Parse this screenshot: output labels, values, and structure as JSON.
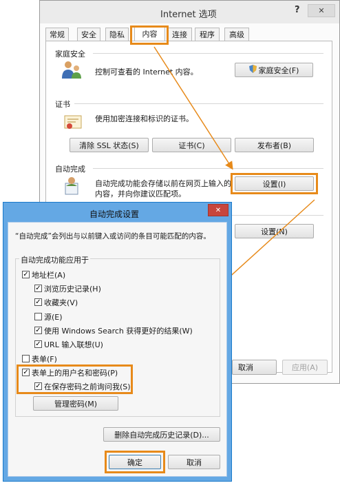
{
  "internet_options": {
    "title": "Internet 选项",
    "help_glyph": "?",
    "close_glyph": "✕",
    "tabs": [
      "常规",
      "安全",
      "隐私",
      "内容",
      "连接",
      "程序",
      "高级"
    ],
    "active_tab": "内容",
    "family_safety": {
      "heading": "家庭安全",
      "description": "控制可查看的 Internet 内容。",
      "button": "家庭安全(F)"
    },
    "certificates": {
      "heading": "证书",
      "description": "使用加密连接和标识的证书。",
      "buttons": [
        "清除 SSL 状态(S)",
        "证书(C)",
        "发布者(B)"
      ]
    },
    "autocomplete": {
      "heading": "自动完成",
      "description_line1": "自动完成功能会存储以前在网页上输入的",
      "description_line2": "内容，并向你建议匹配项。",
      "button": "设置(I)"
    },
    "feeds_button": "设置(N)",
    "bottom_buttons": {
      "cancel": "取消",
      "apply": "应用(A)"
    }
  },
  "autocomplete_dialog": {
    "title": "自动完成设置",
    "close_glyph": "✕",
    "intro": "“自动完成”会列出与以前键入或访问的条目可能匹配的内容。",
    "group_label": "自动完成功能应用于",
    "options": {
      "address_bar": {
        "label": "地址栏(A)",
        "checked": true
      },
      "browsing_history": {
        "label": "浏览历史记录(H)",
        "checked": true
      },
      "favorites": {
        "label": "收藏夹(V)",
        "checked": true
      },
      "feeds": {
        "label": "源(E)",
        "checked": false
      },
      "windows_search": {
        "label": "使用 Windows Search 获得更好的结果(W)",
        "checked": true
      },
      "url_suggest": {
        "label": "URL 输入联想(U)",
        "checked": true
      },
      "forms": {
        "label": "表单(F)",
        "checked": false
      },
      "usernames_passwords": {
        "label": "表单上的用户名和密码(P)",
        "checked": true
      },
      "ask_before_save": {
        "label": "在保存密码之前询问我(S)",
        "checked": true
      }
    },
    "manage_passwords_button": "管理密码(M)",
    "delete_history_button": "删除自动完成历史记录(D)...",
    "ok_button": "确定",
    "cancel_button": "取消"
  },
  "colors": {
    "highlight": "#e78a1a",
    "dialog_border": "#1979ca",
    "close_button": "#c7453c"
  }
}
